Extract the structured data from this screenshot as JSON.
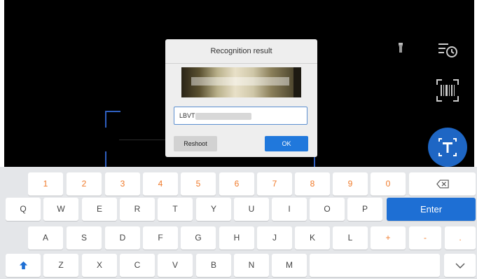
{
  "dialog": {
    "title": "Recognition result",
    "vin_value": "LBVT",
    "reshoot_label": "Reshoot",
    "ok_label": "OK"
  },
  "icons": {
    "flash": "flashlight-icon",
    "history": "history-icon",
    "barcode": "barcode-scan-icon",
    "text": "text-recognition-icon",
    "backspace": "backspace-icon",
    "shift": "shift-icon",
    "hide": "chevron-down-icon"
  },
  "keyboard": {
    "numbers": [
      "1",
      "2",
      "3",
      "4",
      "5",
      "6",
      "7",
      "8",
      "9",
      "0"
    ],
    "row1": [
      "Q",
      "W",
      "E",
      "R",
      "T",
      "Y",
      "U",
      "I",
      "O",
      "P"
    ],
    "enter_label": "Enter",
    "row2": [
      "A",
      "S",
      "D",
      "F",
      "G",
      "H",
      "J",
      "K",
      "L",
      "+",
      "-",
      "."
    ],
    "row3": [
      "Z",
      "X",
      "C",
      "V",
      "B",
      "N",
      "M"
    ]
  },
  "colors": {
    "accent": "#1e6fd4",
    "number_keys": "#f07a2a"
  }
}
